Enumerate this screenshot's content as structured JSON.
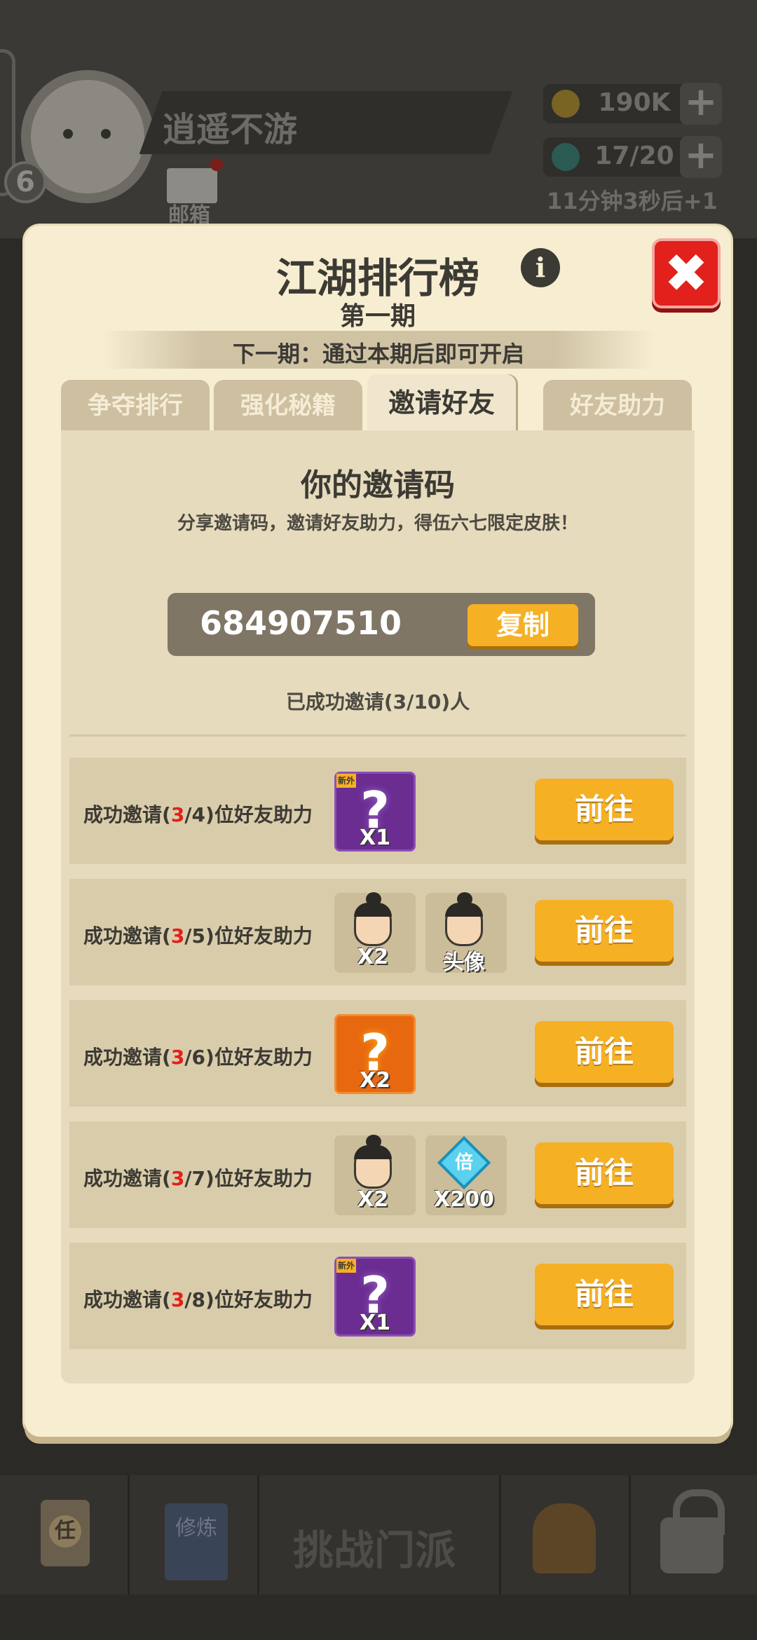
{
  "hud": {
    "level": "6",
    "player_name": "逍遥不游",
    "mail_label": "邮箱",
    "coins": "190K",
    "energy": "17/20",
    "regen_text": "11分钟3秒后+1",
    "plus_symbol": "+"
  },
  "bottom_nav": {
    "task_glyph": "任",
    "train_label": "修炼",
    "main_label": "挑战门派"
  },
  "modal": {
    "title": "江湖排行榜",
    "info_glyph": "i",
    "close_glyph": "✖",
    "period": "第一期",
    "notice": "下一期：通过本期后即可开启",
    "tabs": [
      {
        "label": "争夺排行",
        "active": false
      },
      {
        "label": "强化秘籍",
        "active": false
      },
      {
        "label": "邀请好友",
        "active": true
      },
      {
        "label": "好友助力",
        "active": false
      }
    ]
  },
  "invite": {
    "title": "你的邀请码",
    "description": "分享邀请码，邀请好友助力，得伍六七限定皮肤！",
    "code": "684907510",
    "copy_label": "复制",
    "progress_text": "已成功邀请(3/10)人"
  },
  "rows": [
    {
      "prefix": "成功邀请(",
      "current": "3",
      "target": "/4",
      "suffix": ")位好友助力",
      "button": "前往",
      "rewards": [
        {
          "type": "mystery-purple",
          "badge": "新外",
          "count": "X1"
        }
      ]
    },
    {
      "prefix": "成功邀请(",
      "current": "3",
      "target": "/5",
      "suffix": ")位好友助力",
      "button": "前往",
      "rewards": [
        {
          "type": "character-fragment",
          "count": "X2"
        },
        {
          "type": "avatar",
          "count": "头像"
        }
      ]
    },
    {
      "prefix": "成功邀请(",
      "current": "3",
      "target": "/6",
      "suffix": ")位好友助力",
      "button": "前往",
      "rewards": [
        {
          "type": "mystery-orange",
          "count": "X2"
        }
      ]
    },
    {
      "prefix": "成功邀请(",
      "current": "3",
      "target": "/7",
      "suffix": ")位好友助力",
      "button": "前往",
      "rewards": [
        {
          "type": "character-fragment",
          "count": "X2"
        },
        {
          "type": "multiplier-gem",
          "glyph": "倍",
          "count": "X200"
        }
      ]
    },
    {
      "prefix": "成功邀请(",
      "current": "3",
      "target": "/8",
      "suffix": ")位好友助力",
      "button": "前往",
      "rewards": [
        {
          "type": "mystery-purple",
          "badge": "新外",
          "count": "X1"
        }
      ]
    }
  ],
  "colors": {
    "accent_orange": "#f6b024",
    "progress_red": "#e2201c",
    "panel_bg": "#f7edd1",
    "close_red": "#e2201c"
  }
}
